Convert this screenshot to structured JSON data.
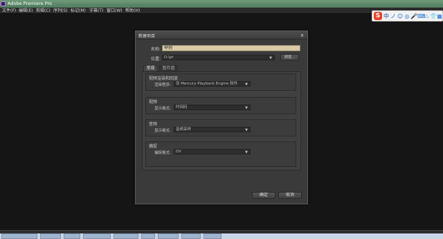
{
  "window": {
    "title": "Adobe Premiere Pro"
  },
  "menu": {
    "items": [
      "文件(F)",
      "编辑(E)",
      "剪辑(C)",
      "序列(S)",
      "标记(M)",
      "字幕(T)",
      "窗口(W)",
      "帮助(H)"
    ]
  },
  "ime": {
    "logo": "S",
    "items": [
      "中",
      "ノ",
      "☺",
      "◎",
      "🎤",
      "⌨",
      "♨",
      "👕",
      "▦"
    ]
  },
  "dialog": {
    "title": "新建项目",
    "close": "x",
    "name_label": "名称:",
    "name_value": "举例",
    "location_label": "位置:",
    "location_value": "D:\\pr",
    "browse_label": "浏览...",
    "tabs": [
      "常规",
      "暂存盘"
    ],
    "render_group": {
      "title": "视频渲染和回放",
      "label": "渲染程序:",
      "value": "仅 Mercury Playback Engine 软件"
    },
    "video_group": {
      "title": "视频",
      "label": "显示格式:",
      "value": "时间码"
    },
    "audio_group": {
      "title": "音频",
      "label": "显示格式:",
      "value": "音频采样"
    },
    "capture_group": {
      "title": "捕捉",
      "label": "捕捉格式:",
      "value": "DV"
    },
    "ok_label": "确定",
    "cancel_label": "取消"
  },
  "colors": {
    "background": "#151515",
    "dialog": "#3a3a3a",
    "name_input": "#d7caa6",
    "titlebar": "#5f8b6c"
  }
}
